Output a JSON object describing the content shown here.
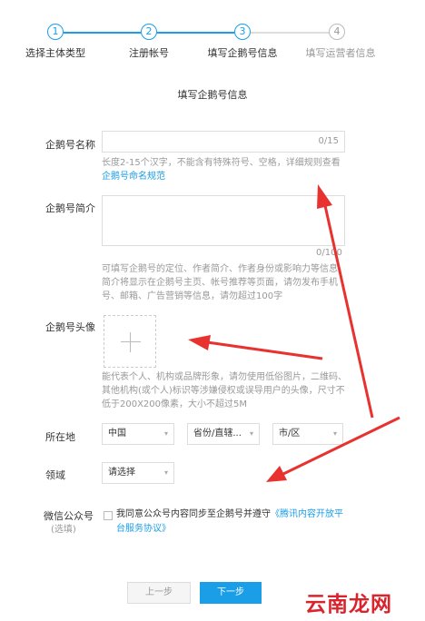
{
  "steps": [
    {
      "num": "1",
      "label": "选择主体类型"
    },
    {
      "num": "2",
      "label": "注册帐号"
    },
    {
      "num": "3",
      "label": "填写企鹅号信息"
    },
    {
      "num": "4",
      "label": "填写运营者信息"
    }
  ],
  "section_title": "填写企鹅号信息",
  "fields": {
    "name": {
      "label": "企鹅号名称",
      "value": "",
      "counter": "0/15",
      "hint": "长度2-15个汉字，不能含有特殊符号、空格，详细规则查看",
      "hint_link": "企鹅号命名规范"
    },
    "intro": {
      "label": "企鹅号简介",
      "value": "",
      "counter": "0/100",
      "hint": "可填写企鹅号的定位、作者简介、作者身份或影响力等信息，简介将显示在企鹅号主页、帐号推荐等页面，请勿发布手机号、邮箱、广告营销等信息，请勿超过100字"
    },
    "avatar": {
      "label": "企鹅号头像",
      "plus_icon": "plus-icon",
      "hint": "能代表个人、机构或品牌形象，请勿使用低俗图片，二维码、其他机构(或个人)标识等涉嫌侵权或误导用户的头像，尺寸不低于200X200像素，大小不超过5M"
    },
    "location": {
      "label": "所在地",
      "country": "中国",
      "province": "省份/直辖...",
      "city": "市/区"
    },
    "domain": {
      "label": "领域",
      "value": "请选择"
    },
    "wechat": {
      "label": "微信公众号",
      "sub_label": "(选填)",
      "agree_text": "我同意公众号内容同步至企鹅号并遵守",
      "agree_link": "《腾讯内容开放平台服务协议》"
    }
  },
  "buttons": {
    "prev": "上一步",
    "next": "下一步"
  },
  "watermark": "云南龙网",
  "colors": {
    "accent": "#1a9ee8",
    "arrow": "#e8322f",
    "watermark": "#d9232d"
  }
}
